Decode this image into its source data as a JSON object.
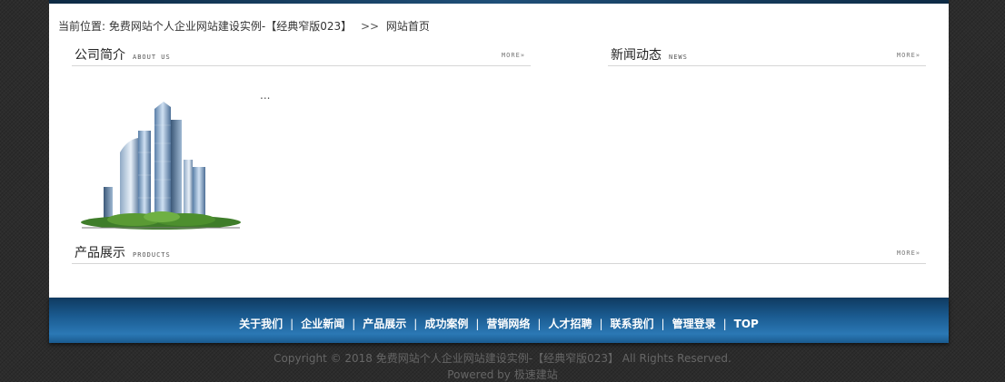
{
  "breadcrumb": {
    "prefix": "当前位置:",
    "site_title": "免费网站个人企业网站建设实例-【经典窄版023】",
    "separator": ">>",
    "current": "网站首页"
  },
  "sections": {
    "about": {
      "title_cn": "公司简介",
      "title_en": "ABOUT US",
      "more": "MORE»",
      "text": "..."
    },
    "news": {
      "title_cn": "新闻动态",
      "title_en": "NEWS",
      "more": "MORE»"
    },
    "products": {
      "title_cn": "产品展示",
      "title_en": "PRODUCTS",
      "more": "MORE»"
    }
  },
  "footer": {
    "nav": [
      "关于我们",
      "企业新闻",
      "产品展示",
      "成功案例",
      "营销网络",
      "人才招聘",
      "联系我们",
      "管理登录",
      "TOP"
    ],
    "divider": "|",
    "copyright": "Copyright © 2018 免费网站个人企业网站建设实例-【经典窄版023】 All Rights Reserved.",
    "powered_prefix": "Powered by",
    "powered_name": "极速建站"
  },
  "colors": {
    "footer_bar": "#1a5a8f",
    "page_bg": "#2c2c2c",
    "content_bg": "#ffffff"
  }
}
